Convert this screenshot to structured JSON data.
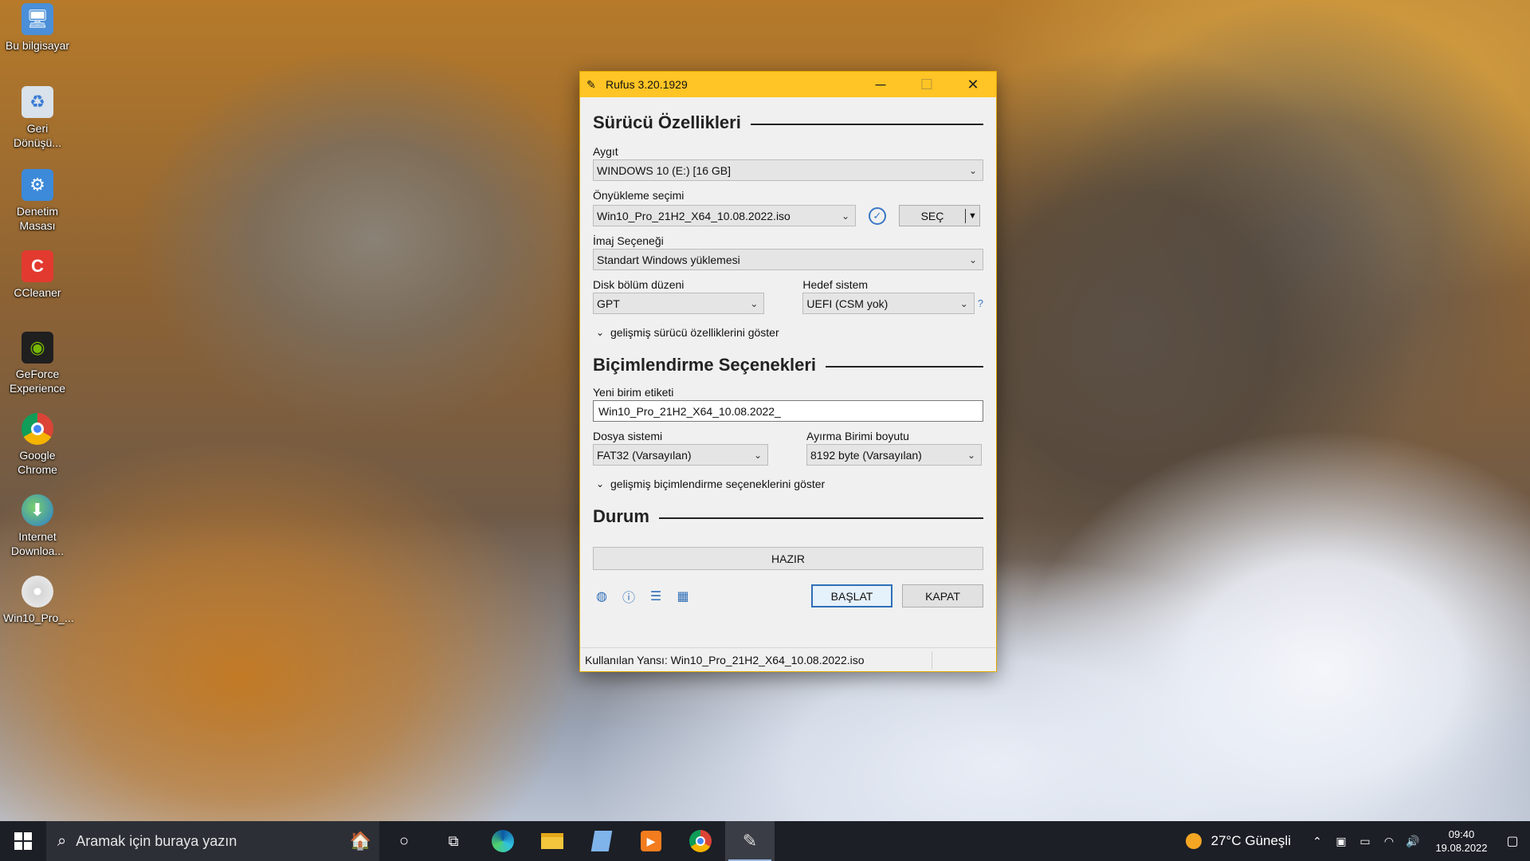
{
  "desktop": {
    "icons": [
      {
        "label": "Bu bilgisayar",
        "icon": "computer-icon"
      },
      {
        "label": "Geri Dönüşü...",
        "icon": "recycle-bin-icon"
      },
      {
        "label": "Denetim Masası",
        "icon": "control-panel-icon"
      },
      {
        "label": "CCleaner",
        "icon": "ccleaner-icon"
      },
      {
        "label": "GeForce Experience",
        "icon": "geforce-icon"
      },
      {
        "label": "Google Chrome",
        "icon": "chrome-icon"
      },
      {
        "label": "Internet Downloa...",
        "icon": "internet-download-manager-icon"
      },
      {
        "label": "Win10_Pro_...",
        "icon": "disc-image-icon"
      }
    ]
  },
  "window": {
    "title": "Rufus 3.20.1929",
    "accent": "#ffc425",
    "minimize": "─",
    "maximize": "☐",
    "close": "✕"
  },
  "drive": {
    "header": "Sürücü Özellikleri",
    "device_label": "Aygıt",
    "device_value": "WINDOWS 10 (E:) [16 GB]",
    "boot_label": "Önyükleme seçimi",
    "boot_value": "Win10_Pro_21H2_X64_10.08.2022.iso",
    "select_button": "SEÇ",
    "image_option_label": "İmaj Seçeneği",
    "image_option_value": "Standart Windows yüklemesi",
    "partition_label": "Disk bölüm düzeni",
    "partition_value": "GPT",
    "target_label": "Hedef sistem",
    "target_value": "UEFI (CSM yok)",
    "help": "?",
    "advanced_toggle": "gelişmiş sürücü özelliklerini göster"
  },
  "format": {
    "header": "Biçimlendirme Seçenekleri",
    "volume_label": "Yeni birim etiketi",
    "volume_value": "Win10_Pro_21H2_X64_10.08.2022_",
    "fs_label": "Dosya sistemi",
    "fs_value": "FAT32 (Varsayılan)",
    "cluster_label": "Ayırma Birimi boyutu",
    "cluster_value": "8192 byte (Varsayılan)",
    "advanced_toggle": "gelişmiş biçimlendirme seçeneklerini göster"
  },
  "status": {
    "header": "Durum",
    "progress_text": "HAZIR",
    "start_button": "BAŞLAT",
    "close_button": "KAPAT",
    "statusbar_text": "Kullanılan Yansı: Win10_Pro_21H2_X64_10.08.2022.iso"
  },
  "taskbar": {
    "search_placeholder": "Aramak için buraya yazın",
    "weather": "27°C Güneşli",
    "time": "09:40",
    "date": "19.08.2022"
  }
}
